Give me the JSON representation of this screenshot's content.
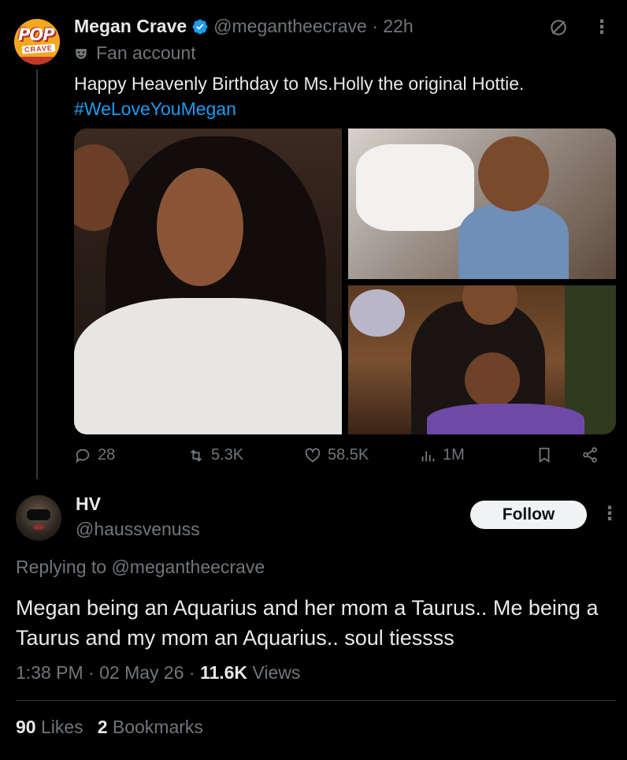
{
  "post": {
    "avatar": {
      "top": "POP",
      "bottom": "CRAVE",
      "icon": "pop-crave-logo"
    },
    "display_name": "Megan Crave",
    "handle_time": "@megantheecrave · 22h",
    "label": "Fan account",
    "text": "Happy Heavenly Birthday to Ms.Holly the original Hottie.",
    "hashtag": "#WeLoveYouMegan",
    "media_count": 3,
    "actions": {
      "replies": "28",
      "reposts": "5.3K",
      "likes": "58.5K",
      "views": "1M"
    }
  },
  "reply": {
    "display_name": "HV",
    "handle": "@haussvenuss",
    "follow_label": "Follow",
    "replying_to": "Replying to @megantheecrave",
    "text": "Megan being an Aquarius and her mom a Taurus.. Me being a Taurus and my mom an Aquarius.. soul tiessss",
    "time": "1:38 PM · 02 May 26 · ",
    "views_count": "11.6K",
    "views_label": " Views",
    "likes_count": "90",
    "likes_label": "Likes",
    "bookmarks_count": "2",
    "bookmarks_label": "Bookmarks"
  },
  "colors": {
    "background": "#000000",
    "text": "#e7e9ea",
    "muted": "#71767b",
    "link": "#1d9bf0",
    "verified": "#1d9bf0"
  }
}
